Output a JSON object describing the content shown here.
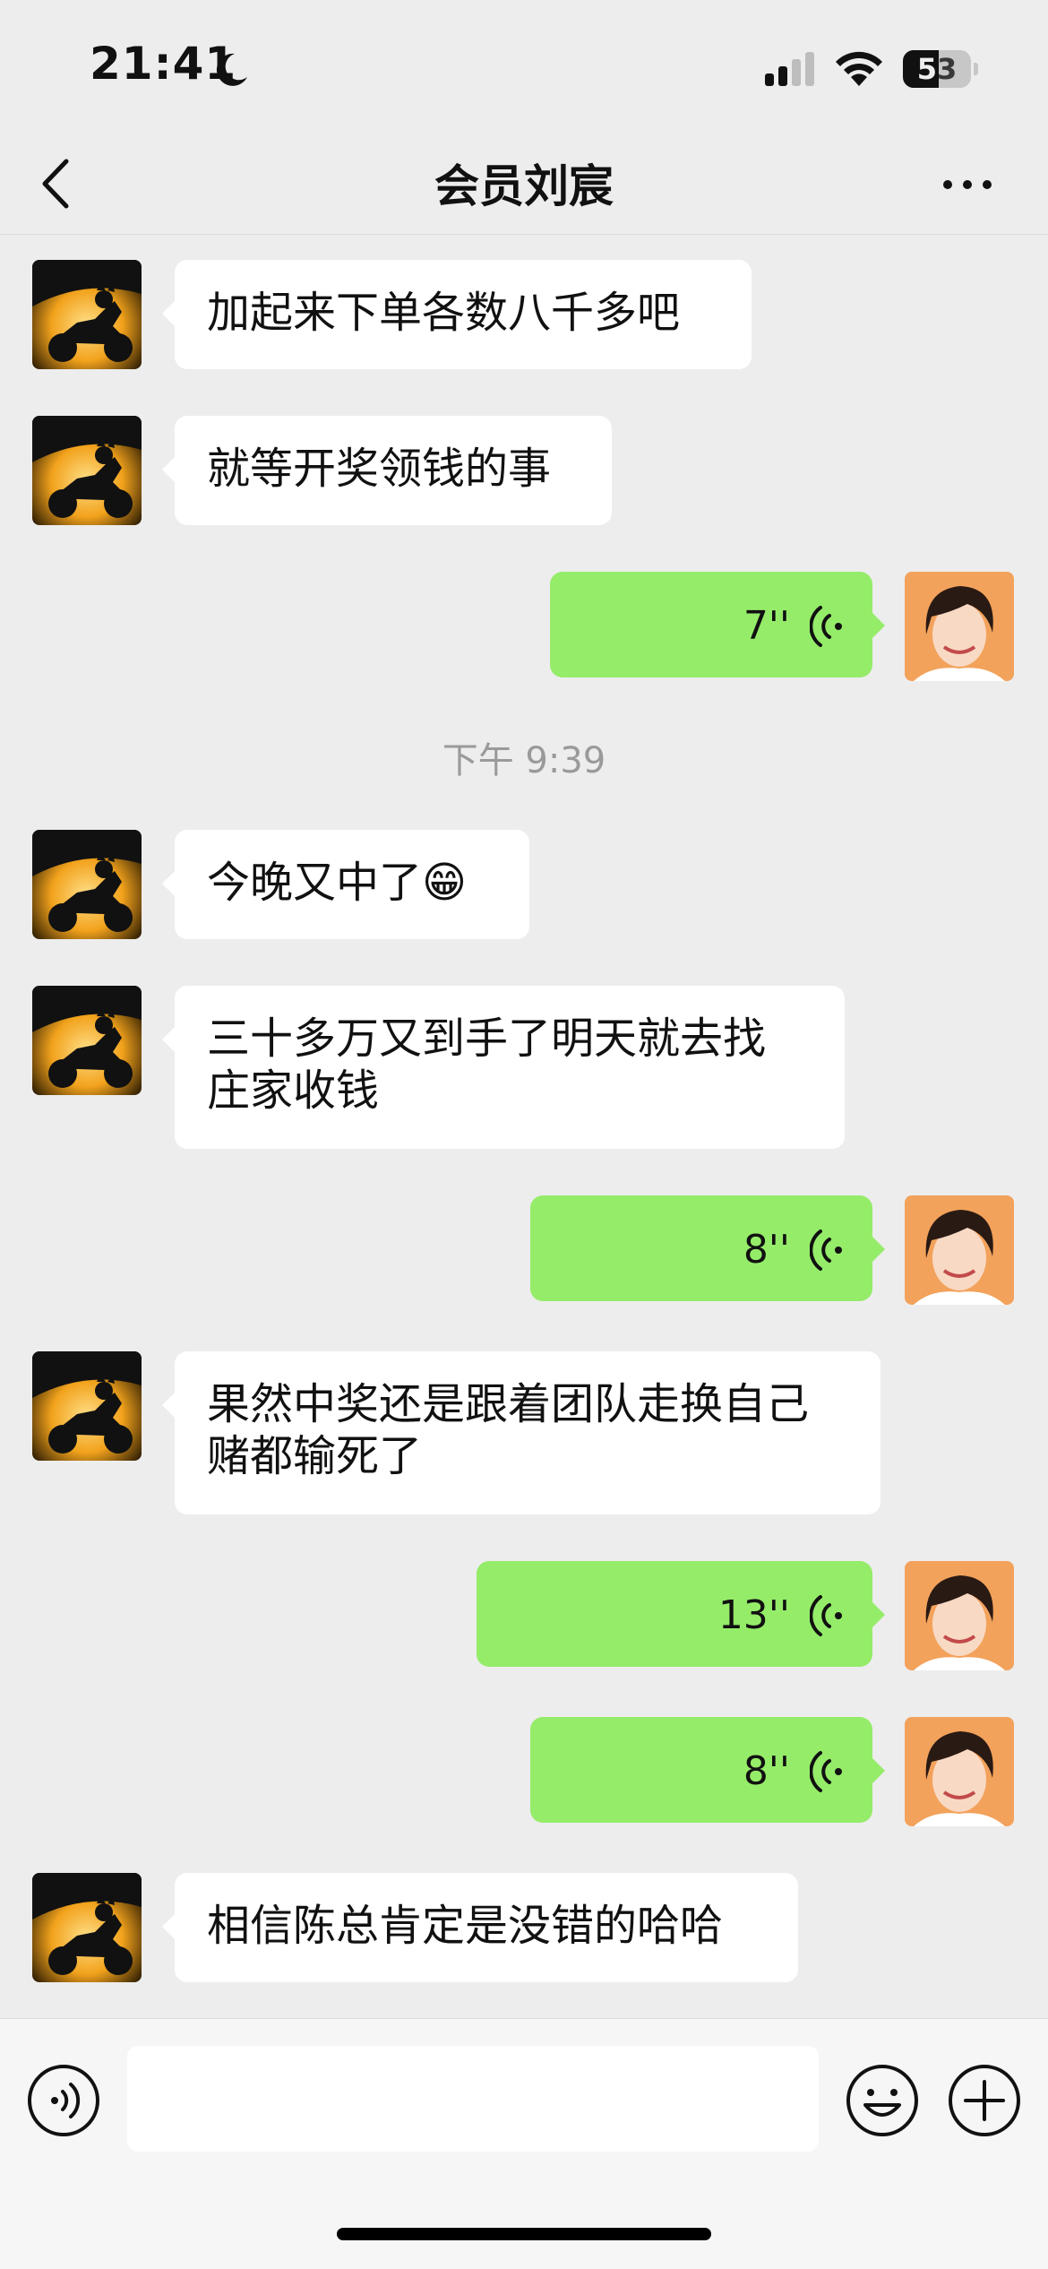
{
  "status_bar": {
    "time": "21:41",
    "battery": "53",
    "battery_level": 0.53
  },
  "nav": {
    "title": "会员刘宸",
    "back_icon": "chevron-left-icon",
    "more_icon": "ellipsis-icon"
  },
  "colors": {
    "background": "#ededed",
    "incoming_bubble": "#ffffff",
    "outgoing_bubble": "#95ec69"
  },
  "messages": [
    {
      "type": "text",
      "side": "left",
      "text": "加起来下单各数八千多吧"
    },
    {
      "type": "text",
      "side": "left",
      "text": "就等开奖领钱的事"
    },
    {
      "type": "voice",
      "side": "right",
      "duration": "7''"
    },
    {
      "type": "timestamp",
      "text": "下午 9:39"
    },
    {
      "type": "text",
      "side": "left",
      "text": "今晚又中了😁"
    },
    {
      "type": "text",
      "side": "left",
      "line1": "三十多万又到手了明天就去找",
      "line2": "庄家收钱"
    },
    {
      "type": "voice",
      "side": "right",
      "duration": "8''"
    },
    {
      "type": "text",
      "side": "left",
      "line1": "果然中奖还是跟着团队走换自己",
      "line2": "赌都输死了"
    },
    {
      "type": "voice",
      "side": "right",
      "duration": "13''"
    },
    {
      "type": "voice",
      "side": "right",
      "duration": "8''"
    },
    {
      "type": "text",
      "side": "left",
      "text": "相信陈总肯定是没错的哈哈"
    }
  ],
  "input_bar": {
    "voice_icon": "voice-toggle-icon",
    "emoji_icon": "emoji-icon",
    "plus_icon": "plus-icon",
    "placeholder": ""
  }
}
